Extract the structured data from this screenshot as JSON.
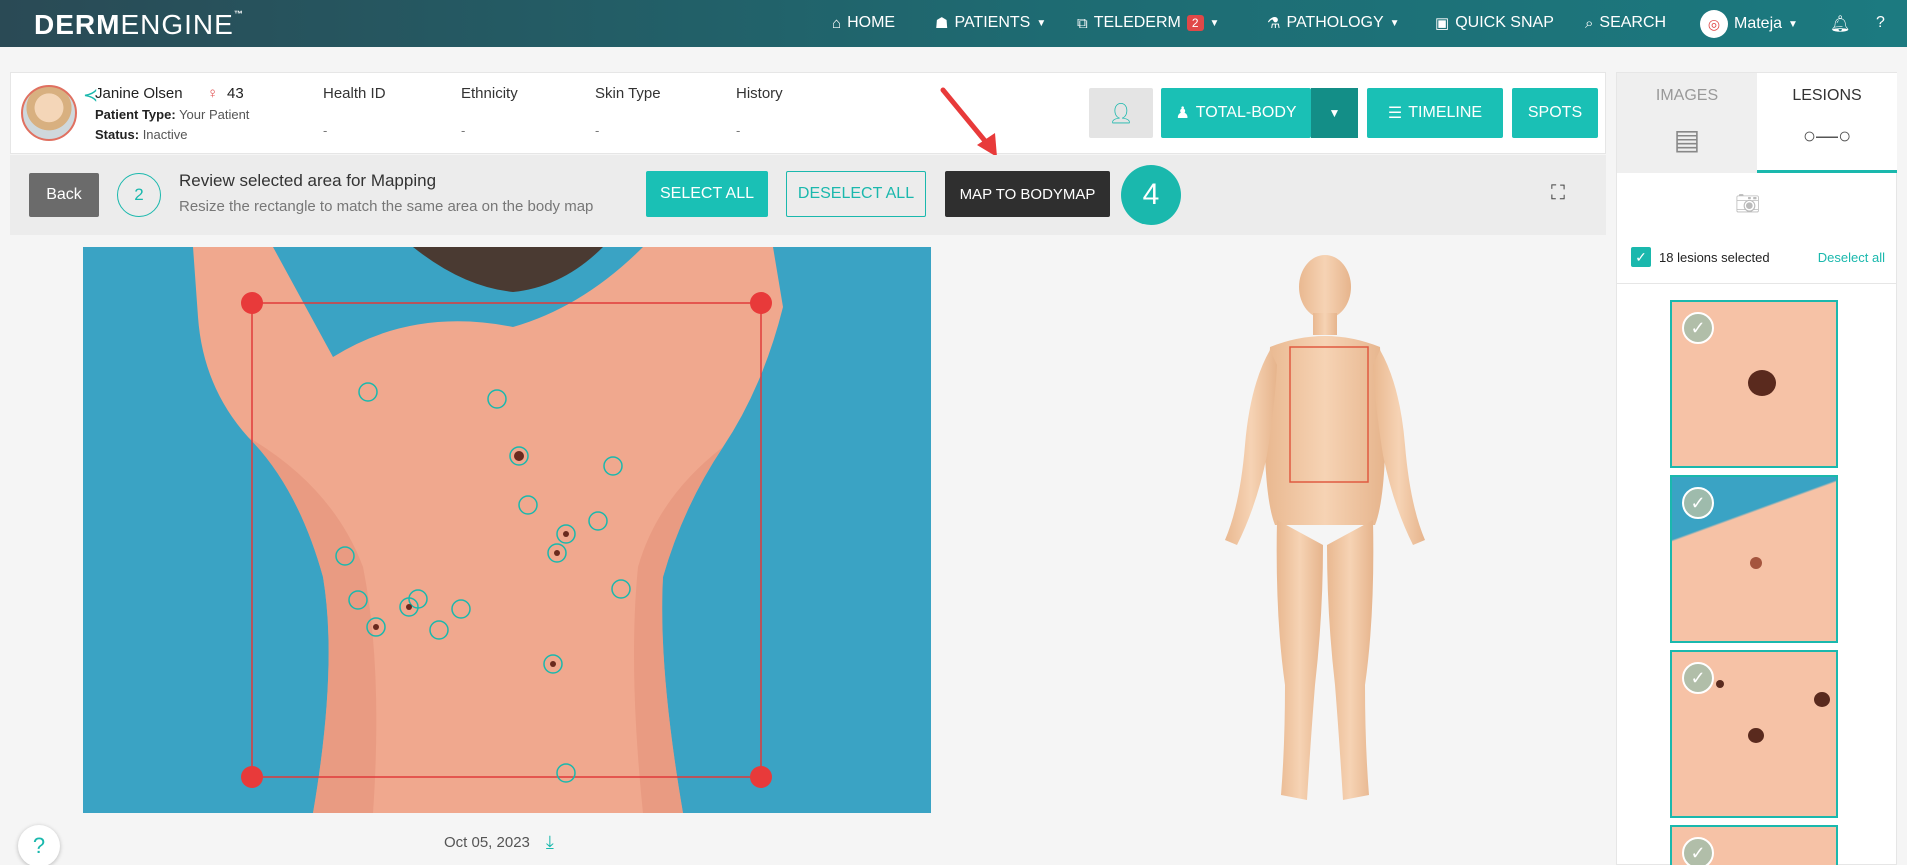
{
  "nav": {
    "logo_bold": "DERM",
    "logo_thin": "ENGINE",
    "logo_tm": "™",
    "home": "HOME",
    "patients": "PATIENTS",
    "telederm": "TELEDERM",
    "telederm_badge": "2",
    "pathology": "PATHOLOGY",
    "quick_snap": "QUICK SNAP",
    "search": "SEARCH",
    "user": "Mateja"
  },
  "patient": {
    "name": "Janine Olsen",
    "age": "43",
    "type_label": "Patient Type:",
    "type_value": "Your Patient",
    "status_label": "Status:",
    "status_value": "Inactive",
    "columns": [
      {
        "header": "Health ID",
        "value": "-"
      },
      {
        "header": "Ethnicity",
        "value": "-"
      },
      {
        "header": "Skin Type",
        "value": "-"
      },
      {
        "header": "History",
        "value": "-"
      }
    ]
  },
  "actions": {
    "total_body": "TOTAL-BODY",
    "timeline": "TIMELINE",
    "spots": "SPOTS"
  },
  "toolbar": {
    "back": "Back",
    "step_number": "2",
    "title": "Review selected area for Mapping",
    "subtitle": "Resize the rectangle to match the same area on the body map",
    "select_all": "SELECT ALL",
    "deselect_all": "DESELECT ALL",
    "map_to_bodymap": "MAP TO BODYMAP",
    "callout_number": "4"
  },
  "photo": {
    "date": "Oct 05, 2023"
  },
  "right_panel": {
    "tab_images": "IMAGES",
    "tab_lesions": "LESIONS",
    "selected_count": "18 lesions selected",
    "deselect_all": "Deselect all"
  },
  "colors": {
    "accent": "#1ab8ad",
    "nav_dark": "#2a4a55",
    "selection_red": "#e03a3a",
    "dark_button": "#2f2f2f"
  }
}
